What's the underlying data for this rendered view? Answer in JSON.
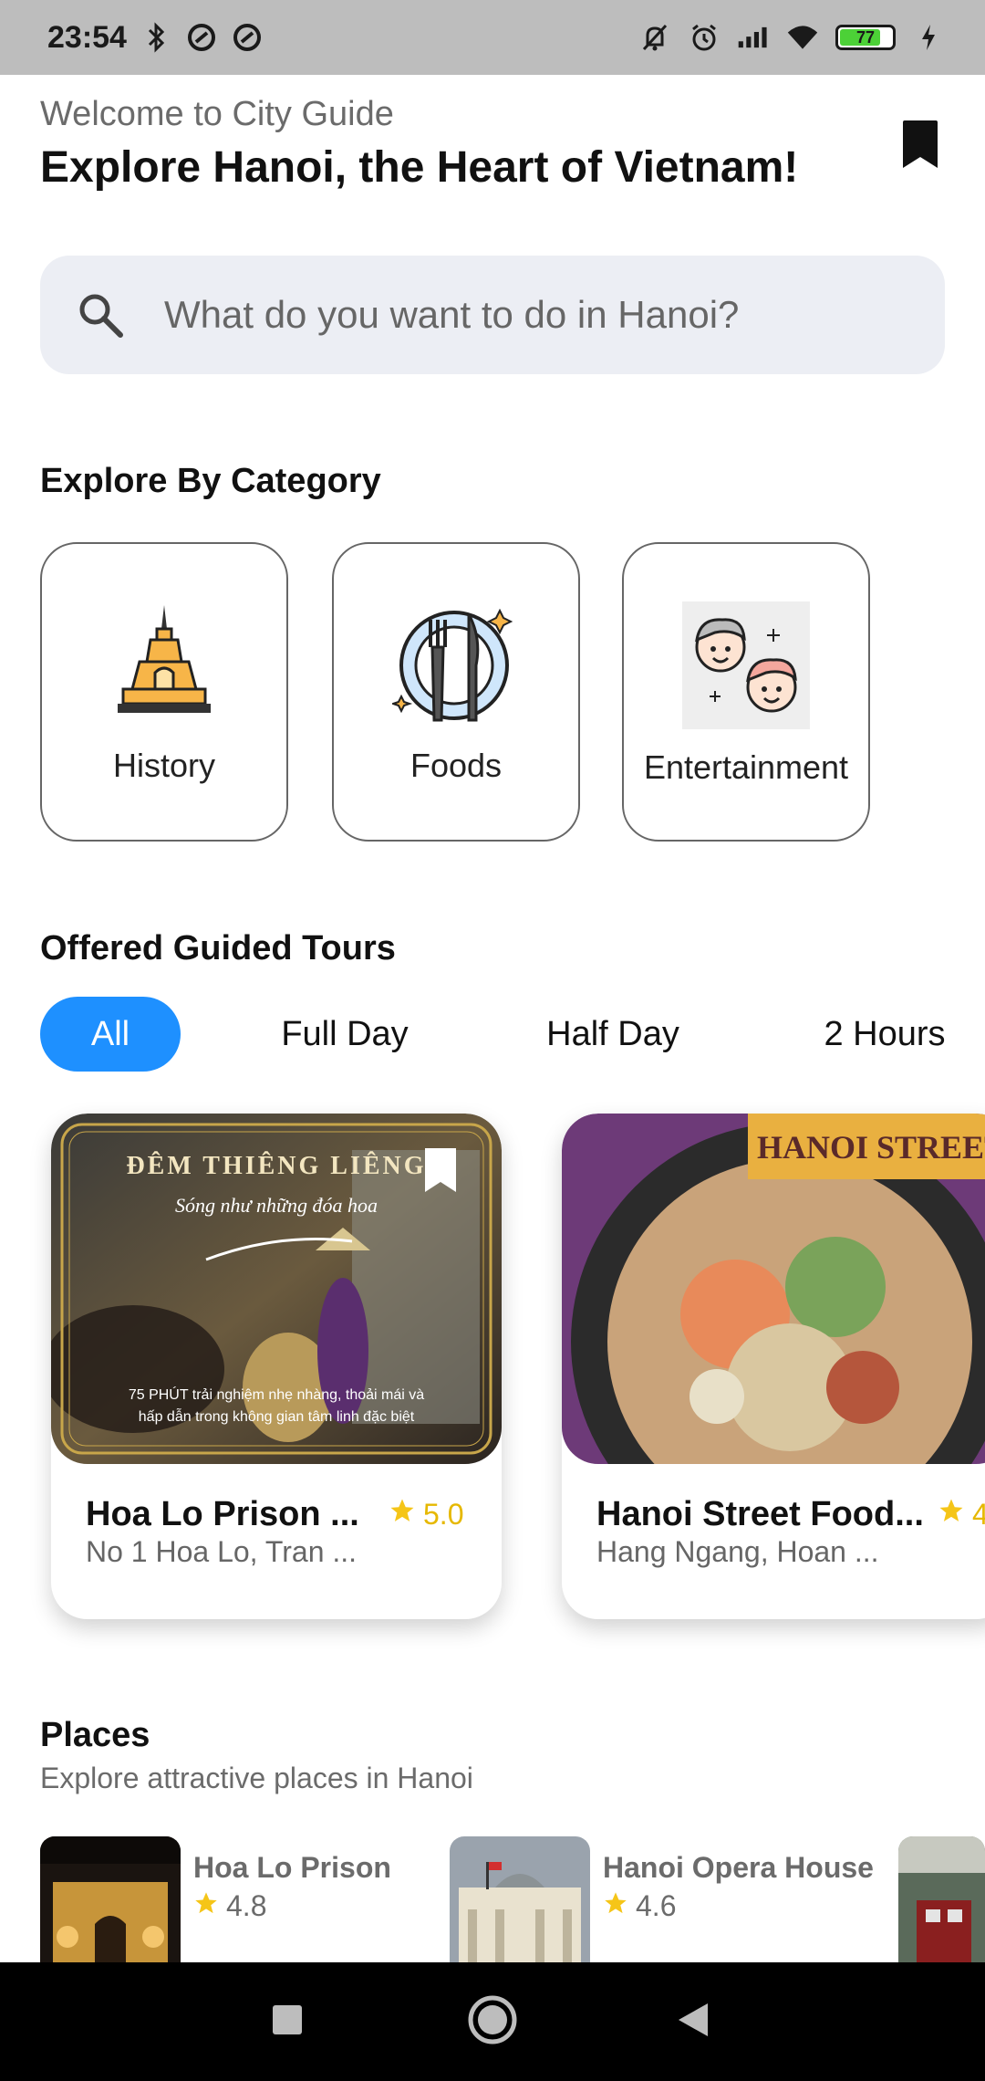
{
  "status_bar": {
    "time": "23:54",
    "battery": "77"
  },
  "header": {
    "welcome": "Welcome to City Guide",
    "title": "Explore Hanoi, the Heart of Vietnam!"
  },
  "search": {
    "placeholder": "What do you want to do in Hanoi?"
  },
  "categories": {
    "title": "Explore By Category",
    "items": [
      {
        "label": "History",
        "icon": "pagoda-icon"
      },
      {
        "label": "Foods",
        "icon": "plate-fork-knife-icon"
      },
      {
        "label": "Entertainment",
        "icon": "happy-faces-icon"
      }
    ]
  },
  "tours": {
    "title": "Offered Guided Tours",
    "tabs": [
      "All",
      "Full Day",
      "Half Day",
      "2 Hours"
    ],
    "active_tab": "All",
    "cards": [
      {
        "title": "Hoa Lo Prison ...",
        "address": "No 1 Hoa Lo, Tran ...",
        "rating": "5.0",
        "image_heading": "ĐÊM THIÊNG LIÊNG",
        "image_script": "Sóng như những đóa hoa",
        "image_caption_1": "75 PHÚT trải nghiệm nhẹ nhàng, thoải mái và",
        "image_caption_2": "hấp dẫn trong không gian tâm linh đặc biệt"
      },
      {
        "title": "Hanoi Street Food...",
        "address": "Hang Ngang, Hoan ...",
        "rating": "4",
        "image_banner": "HANOI STREET FO"
      }
    ]
  },
  "places": {
    "title": "Places",
    "subtitle": "Explore attractive places in Hanoi",
    "items": [
      {
        "name": "Hoa Lo Prison",
        "rating": "4.8"
      },
      {
        "name": "Hanoi Opera House",
        "rating": "4.6"
      }
    ]
  },
  "colors": {
    "accent": "#1e90ff",
    "star": "#f5c518",
    "search_bg": "#eceef4"
  }
}
